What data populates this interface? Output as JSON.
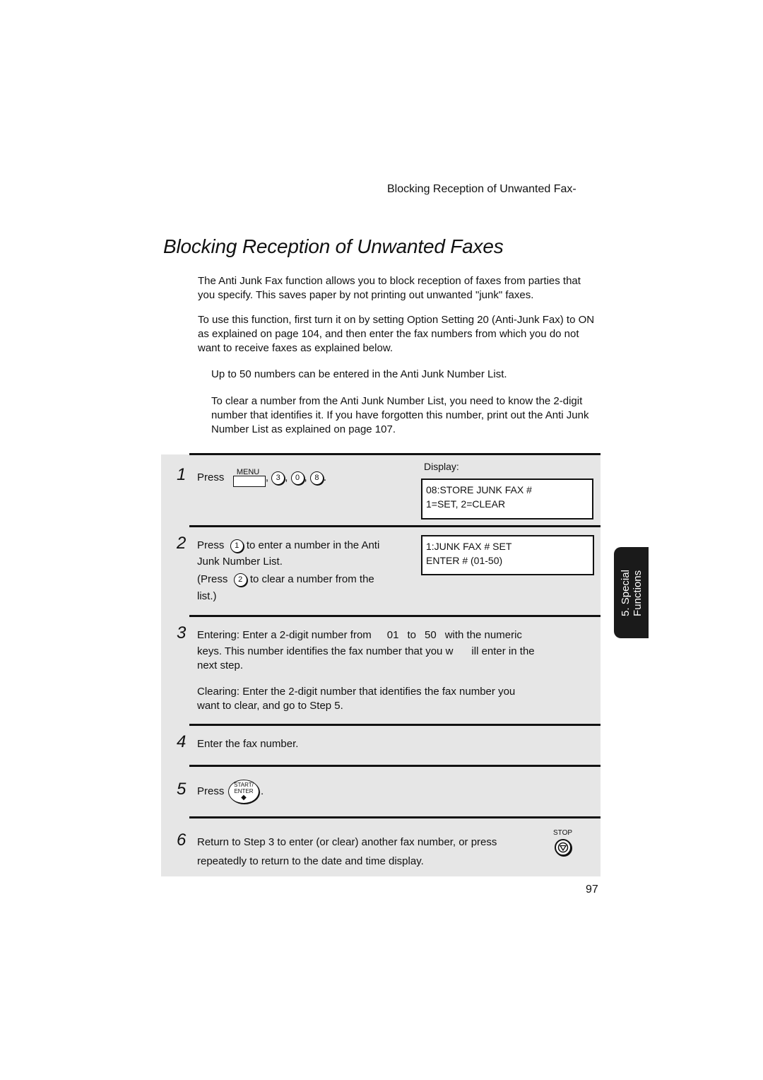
{
  "running_head": "Blocking Reception of Unwanted Fax-",
  "title": "Blocking Reception of Unwanted Faxes",
  "intro": [
    "The Anti Junk Fax function allows you to block reception of faxes from parties that you specify. This saves paper by not printing out unwanted \"junk\" faxes.",
    "To use this function, first turn it on by setting Option Setting 20 (Anti-Junk Fax) to ON as explained on page 104, and then enter the fax numbers from which you do not want to receive faxes as explained below."
  ],
  "notes": [
    "Up to 50 numbers can be entered in the Anti Junk Number List.",
    "To clear a number from the Anti Junk Number List, you need to know the 2-digit number that identifies it. If you have forgotten this number, print out the Anti Junk Number List as explained on page 107."
  ],
  "display_label": "Display:",
  "keys": {
    "menu": "MENU",
    "k3": "3",
    "k0": "0",
    "k8": "8",
    "k1": "1",
    "k2": "2",
    "start_line1": "START/",
    "start_line2": "ENTER",
    "stop": "STOP"
  },
  "steps": [
    {
      "num": "1",
      "press": "Press",
      "sep": ",",
      "end": ".",
      "lcd": [
        "08:STORE JUNK FAX #",
        "1=SET, 2=CLEAR"
      ]
    },
    {
      "num": "2",
      "line1a": "Press",
      "line1b": "to enter a number in the Anti",
      "line2": "Junk Number List.",
      "line3a": "(Press",
      "line3b": "to clear a number from the",
      "line4": "list.)",
      "lcd": [
        "1:JUNK FAX # SET",
        "ENTER # (01-50)"
      ]
    },
    {
      "num": "3",
      "line1a": "Entering: Enter a 2-digit number from",
      "line1b": "01",
      "line1c": "to",
      "line1d": "50",
      "line1e": "with the numeric",
      "line2a": "keys. This number identifies the fax number that you w",
      "line2b": "ill enter in the",
      "line3": "next step.",
      "line4": "Clearing: Enter the 2-digit number that identifies the fax number you",
      "line5": "want to clear, and go to Step 5."
    },
    {
      "num": "4",
      "text": "Enter the fax number."
    },
    {
      "num": "5",
      "press": "Press",
      "end": "."
    },
    {
      "num": "6",
      "line1": "Return to Step 3 to enter (or clear) another fax number, or press",
      "line2": "repeatedly to return to the date and time display."
    }
  ],
  "side_tab": {
    "line1": "5. Special",
    "line2": "Functions"
  },
  "page_number": "97"
}
